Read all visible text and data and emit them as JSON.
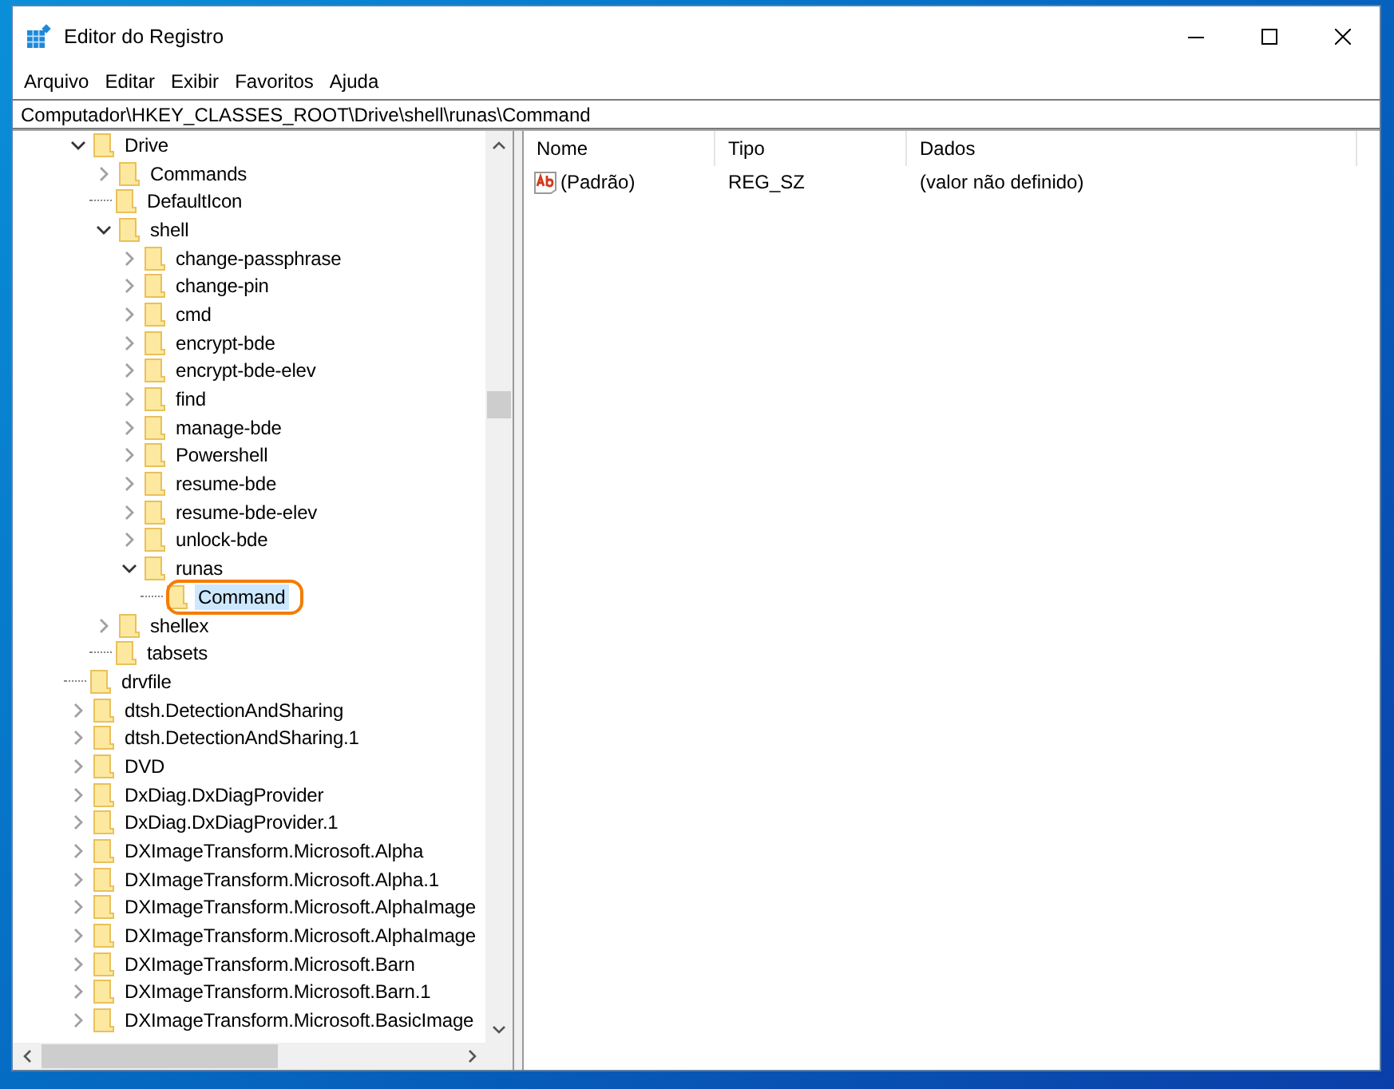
{
  "window": {
    "title": "Editor do Registro"
  },
  "menu": [
    "Arquivo",
    "Editar",
    "Exibir",
    "Favoritos",
    "Ajuda"
  ],
  "address": {
    "value": "Computador\\HKEY_CLASSES_ROOT\\Drive\\shell\\runas\\Command"
  },
  "tree": [
    {
      "label": "Drive",
      "kind": "node",
      "expanded": true,
      "selected": false,
      "children": [
        {
          "label": "Commands",
          "kind": "node",
          "expanded": false,
          "selected": false
        },
        {
          "label": "DefaultIcon",
          "kind": "leaf",
          "selected": false
        },
        {
          "label": "shell",
          "kind": "node",
          "expanded": true,
          "selected": false,
          "children": [
            {
              "label": "change-passphrase",
              "kind": "node",
              "expanded": false,
              "selected": false
            },
            {
              "label": "change-pin",
              "kind": "node",
              "expanded": false,
              "selected": false
            },
            {
              "label": "cmd",
              "kind": "node",
              "expanded": false,
              "selected": false
            },
            {
              "label": "encrypt-bde",
              "kind": "node",
              "expanded": false,
              "selected": false
            },
            {
              "label": "encrypt-bde-elev",
              "kind": "node",
              "expanded": false,
              "selected": false
            },
            {
              "label": "find",
              "kind": "node",
              "expanded": false,
              "selected": false
            },
            {
              "label": "manage-bde",
              "kind": "node",
              "expanded": false,
              "selected": false
            },
            {
              "label": "Powershell",
              "kind": "node",
              "expanded": false,
              "selected": false
            },
            {
              "label": "resume-bde",
              "kind": "node",
              "expanded": false,
              "selected": false
            },
            {
              "label": "resume-bde-elev",
              "kind": "node",
              "expanded": false,
              "selected": false
            },
            {
              "label": "unlock-bde",
              "kind": "node",
              "expanded": false,
              "selected": false
            },
            {
              "label": "runas",
              "kind": "node",
              "expanded": true,
              "selected": false,
              "children": [
                {
                  "label": "Command",
                  "kind": "leaf",
                  "selected": true,
                  "highlighted": true
                }
              ]
            }
          ]
        },
        {
          "label": "shellex",
          "kind": "node",
          "expanded": false,
          "selected": false
        },
        {
          "label": "tabsets",
          "kind": "leaf",
          "selected": false
        }
      ]
    },
    {
      "label": "drvfile",
      "kind": "leaf",
      "selected": false
    },
    {
      "label": "dtsh.DetectionAndSharing",
      "kind": "node",
      "expanded": false,
      "selected": false
    },
    {
      "label": "dtsh.DetectionAndSharing.1",
      "kind": "node",
      "expanded": false,
      "selected": false
    },
    {
      "label": "DVD",
      "kind": "node",
      "expanded": false,
      "selected": false
    },
    {
      "label": "DxDiag.DxDiagProvider",
      "kind": "node",
      "expanded": false,
      "selected": false
    },
    {
      "label": "DxDiag.DxDiagProvider.1",
      "kind": "node",
      "expanded": false,
      "selected": false
    },
    {
      "label": "DXImageTransform.Microsoft.Alpha",
      "kind": "node",
      "expanded": false,
      "selected": false
    },
    {
      "label": "DXImageTransform.Microsoft.Alpha.1",
      "kind": "node",
      "expanded": false,
      "selected": false
    },
    {
      "label": "DXImageTransform.Microsoft.AlphaImage",
      "kind": "node",
      "expanded": false,
      "selected": false
    },
    {
      "label": "DXImageTransform.Microsoft.AlphaImage",
      "kind": "node",
      "expanded": false,
      "selected": false
    },
    {
      "label": "DXImageTransform.Microsoft.Barn",
      "kind": "node",
      "expanded": false,
      "selected": false
    },
    {
      "label": "DXImageTransform.Microsoft.Barn.1",
      "kind": "node",
      "expanded": false,
      "selected": false
    },
    {
      "label": "DXImageTransform.Microsoft.BasicImage",
      "kind": "node",
      "expanded": false,
      "selected": false
    }
  ],
  "values": {
    "columns": [
      "Nome",
      "Tipo",
      "Dados"
    ],
    "rows": [
      {
        "name": "(Padrão)",
        "type": "REG_SZ",
        "data": "(valor não definido)"
      }
    ]
  }
}
